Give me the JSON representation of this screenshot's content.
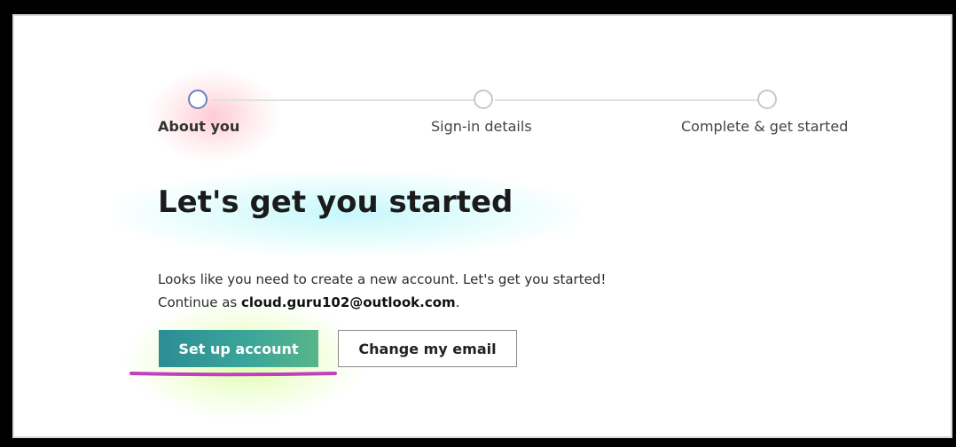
{
  "stepper": {
    "steps": [
      {
        "label": "About you",
        "active": true
      },
      {
        "label": "Sign-in details",
        "active": false
      },
      {
        "label": "Complete & get started",
        "active": false
      }
    ]
  },
  "main": {
    "title": "Let's get you started",
    "line1": "Looks like you need to create a new account. Let's get you started!",
    "line2_prefix": "Continue as ",
    "email": "cloud.guru102@outlook.com",
    "line2_suffix": "."
  },
  "buttons": {
    "primary_label": "Set up account",
    "secondary_label": "Change my email"
  },
  "colors": {
    "primary_button": "#3aa59a",
    "annotation_underline": "#c040c0",
    "active_step": "#6f7fbf"
  }
}
